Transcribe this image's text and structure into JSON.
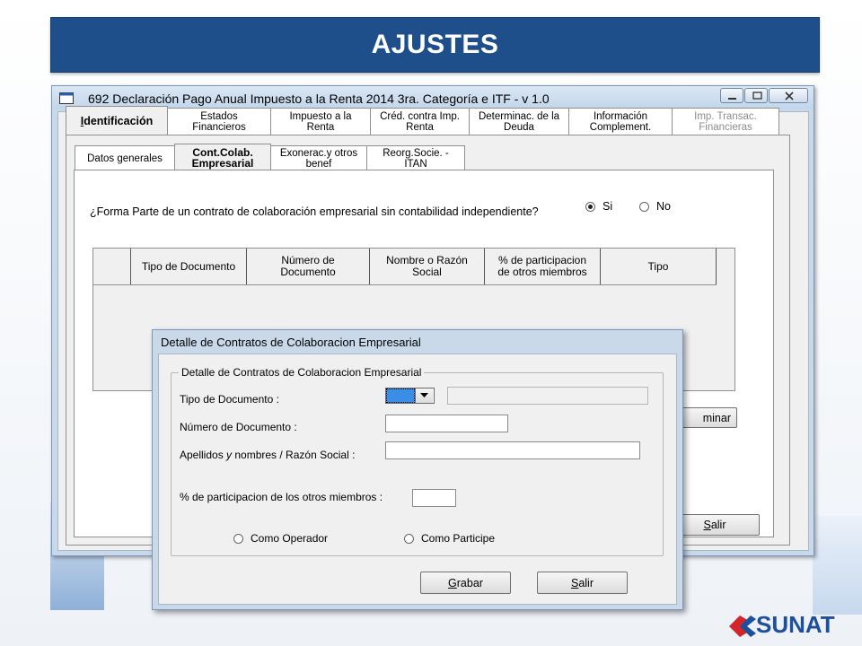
{
  "slide_title": "AJUSTES",
  "window": {
    "title": "692 Declaración Pago Anual Impuesto a la Renta 2014 3ra. Categoría e ITF - v 1.0",
    "icon": "app-icon"
  },
  "main_tabs": [
    {
      "line1": "Identificación",
      "line2": "",
      "active": true,
      "disabled": false
    },
    {
      "line1": "Estados",
      "line2": "Financieros",
      "active": false,
      "disabled": false
    },
    {
      "line1": "Impuesto a  la",
      "line2": "Renta",
      "active": false,
      "disabled": false
    },
    {
      "line1": "Créd. contra Imp.",
      "line2": "Renta",
      "active": false,
      "disabled": false
    },
    {
      "line1": "Determinac. de la",
      "line2": "Deuda",
      "active": false,
      "disabled": false
    },
    {
      "line1": "Información",
      "line2": "Complement.",
      "active": false,
      "disabled": false
    },
    {
      "line1": "Imp. Transac.",
      "line2": "Financieras",
      "active": false,
      "disabled": true
    }
  ],
  "sub_tabs": [
    {
      "line1": "Datos generales",
      "line2": "",
      "active": false
    },
    {
      "line1": "Cont.Colab.",
      "line2": "Empresarial",
      "active": true
    },
    {
      "line1": "Exonerac.y otros",
      "line2": "benef",
      "active": false
    },
    {
      "line1": "Reorg.Socie. -",
      "line2": "ITAN",
      "active": false
    }
  ],
  "question": "¿Forma Parte de un contrato de colaboración empresarial sin contabilidad independiente?",
  "radio_si": "Si",
  "radio_no": "No",
  "grid_headers": [
    {
      "line1": "",
      "line2": ""
    },
    {
      "line1": "Tipo de Documento",
      "line2": ""
    },
    {
      "line1": "Número de",
      "line2": "Documento"
    },
    {
      "line1": "Nombre o Razón",
      "line2": "Social"
    },
    {
      "line1": "%  de participacion",
      "line2": "de otros miembros"
    },
    {
      "line1": "Tipo",
      "line2": ""
    }
  ],
  "main_buttons": {
    "eliminar_visible": "minar",
    "salir": "Salir"
  },
  "dialog": {
    "title": "Detalle de Contratos de  Colaboracion Empresarial",
    "group_title": "Detalle de Contratos de Colaboracion Empresarial",
    "tipo_documento_label": "Tipo de Documento :",
    "numero_documento_label": "Número de Documento :",
    "apellidos_label": "Apellidos y nombres / Razón Social :",
    "participacion_label": "% de participacion de los otros miembros :",
    "como_operador": "Como Operador",
    "como_participe": "Como Participe",
    "grabar": "Grabar",
    "salir": "Salir"
  },
  "logo_text": "SUNAT",
  "colors": {
    "title_bar": "#1f4f8a",
    "logo": "#1c4f9c",
    "logo_accent": "#d3252b"
  }
}
